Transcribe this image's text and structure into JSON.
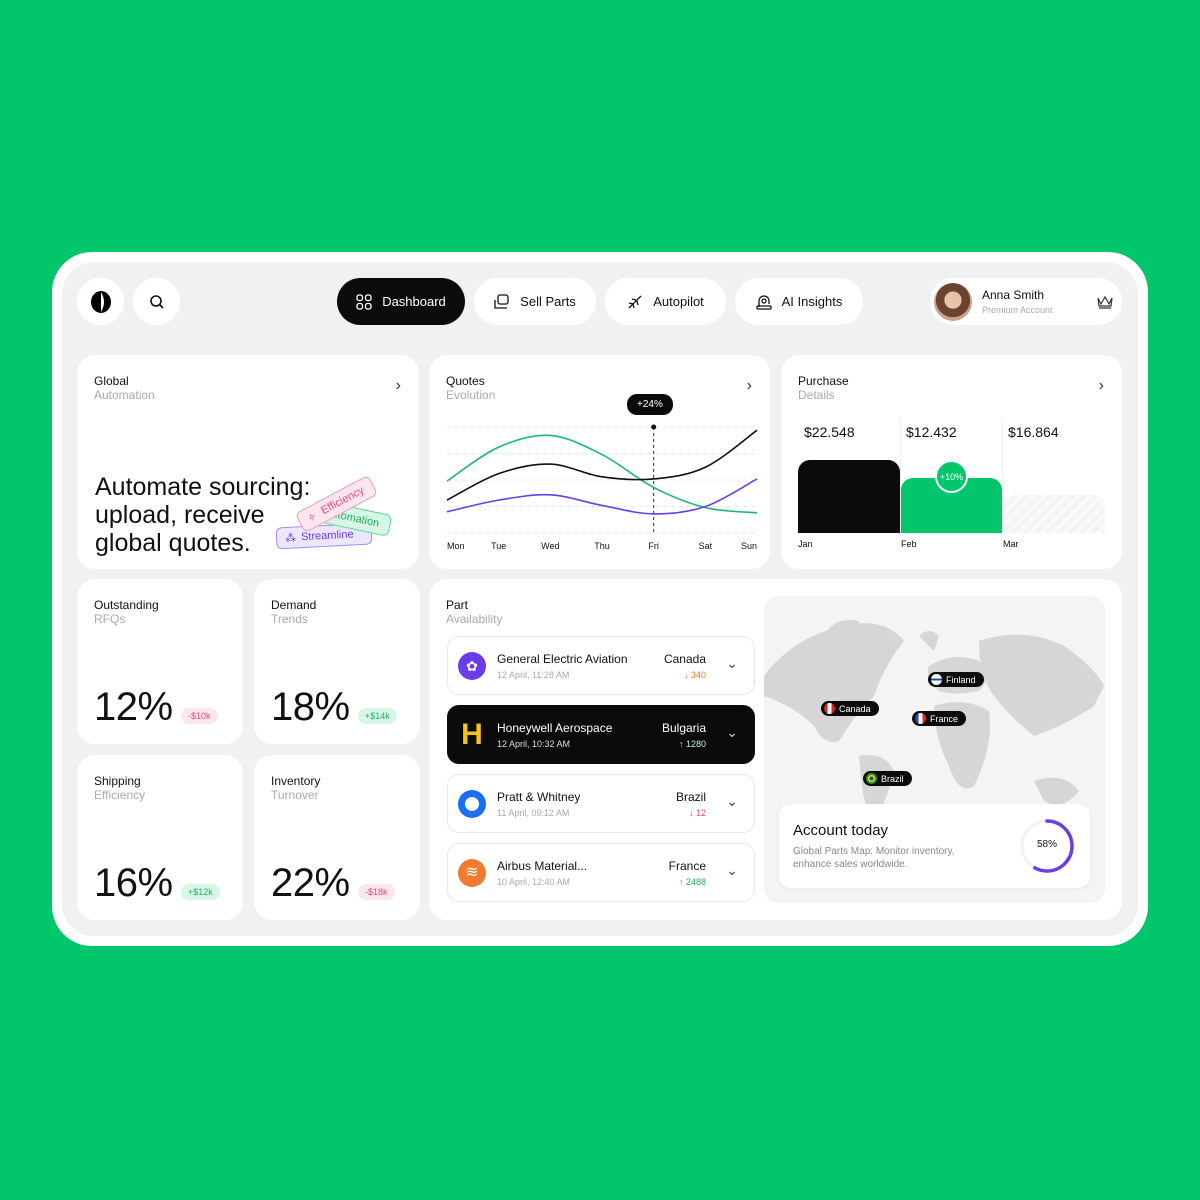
{
  "nav": {
    "items": [
      {
        "label": "Dashboard",
        "icon": "grid-icon",
        "active": true
      },
      {
        "label": "Sell Parts",
        "icon": "sell-icon"
      },
      {
        "label": "Autopilot",
        "icon": "plane-icon"
      },
      {
        "label": "AI Insights",
        "icon": "ai-icon"
      }
    ],
    "user": {
      "name": "Anna Smith",
      "role": "Premium Account"
    }
  },
  "global": {
    "title": "Global",
    "subtitle": "Automation",
    "headline": [
      "Automate sourcing:",
      "upload, receive",
      "global quotes."
    ],
    "tags": [
      "Efficiency",
      "Automation",
      "Streamline"
    ]
  },
  "quotes": {
    "title": "Quotes",
    "subtitle": "Evolution",
    "tooltip": "+24%"
  },
  "purchase": {
    "title": "Purchase",
    "subtitle": "Details",
    "months": [
      {
        "label": "Jan",
        "value": "$22.548"
      },
      {
        "label": "Feb",
        "value": "$12.432",
        "badge": "+10%"
      },
      {
        "label": "Mar",
        "value": "$16.864"
      }
    ]
  },
  "stats": [
    {
      "title": "Outstanding",
      "subtitle": "RFQs",
      "value": "12%",
      "delta": "-$10k",
      "dir": "neg"
    },
    {
      "title": "Demand",
      "subtitle": "Trends",
      "value": "18%",
      "delta": "+$14k",
      "dir": "pos"
    },
    {
      "title": "Shipping",
      "subtitle": "Efficiency",
      "value": "16%",
      "delta": "+$12k",
      "dir": "pos"
    },
    {
      "title": "Inventory",
      "subtitle": "Turnover",
      "value": "22%",
      "delta": "-$18k",
      "dir": "neg"
    }
  ],
  "parts": {
    "title": "Part",
    "subtitle": "Availability",
    "rows": [
      {
        "name": "General Electric Aviation",
        "date": "12 April, 11:28 AM",
        "country": "Canada",
        "change": "↓ 340",
        "color": "#f07a2e"
      },
      {
        "name": "Honeywell Aerospace",
        "date": "12 April, 10:32 AM",
        "country": "Bulgaria",
        "change": "↑ 1280",
        "color": "#bff0d6"
      },
      {
        "name": "Pratt & Whitney",
        "date": "11 April, 09:12 AM",
        "country": "Brazil",
        "change": "↓ 12",
        "color": "#e64b7c"
      },
      {
        "name": "Airbus Material...",
        "date": "10 April, 12:40 AM",
        "country": "France",
        "change": "↑ 2488",
        "color": "#1fae63"
      }
    ]
  },
  "map": {
    "pins": [
      "Finland",
      "Canada",
      "France",
      "Brazil"
    ],
    "account": {
      "title": "Account today",
      "text": "Global Parts Map: Monitor inventory, enhance sales worldwide.",
      "percent": 58,
      "percent_label": "58%"
    }
  },
  "chart_data": {
    "type": "line",
    "categories": [
      "Mon",
      "Tue",
      "Wed",
      "Thu",
      "Fri",
      "Sat",
      "Sun"
    ],
    "series": [
      {
        "color": "#1bb877",
        "values": [
          49,
          81,
          92,
          74,
          43,
          24,
          19
        ]
      },
      {
        "color": "#111111",
        "values": [
          31,
          56,
          65,
          53,
          51,
          62,
          97
        ]
      },
      {
        "color": "#6a3de8",
        "values": [
          20,
          31,
          36,
          26,
          18,
          25,
          51
        ]
      }
    ],
    "ylim": [
      0,
      100
    ],
    "highlight": "Fri",
    "grid": true
  }
}
